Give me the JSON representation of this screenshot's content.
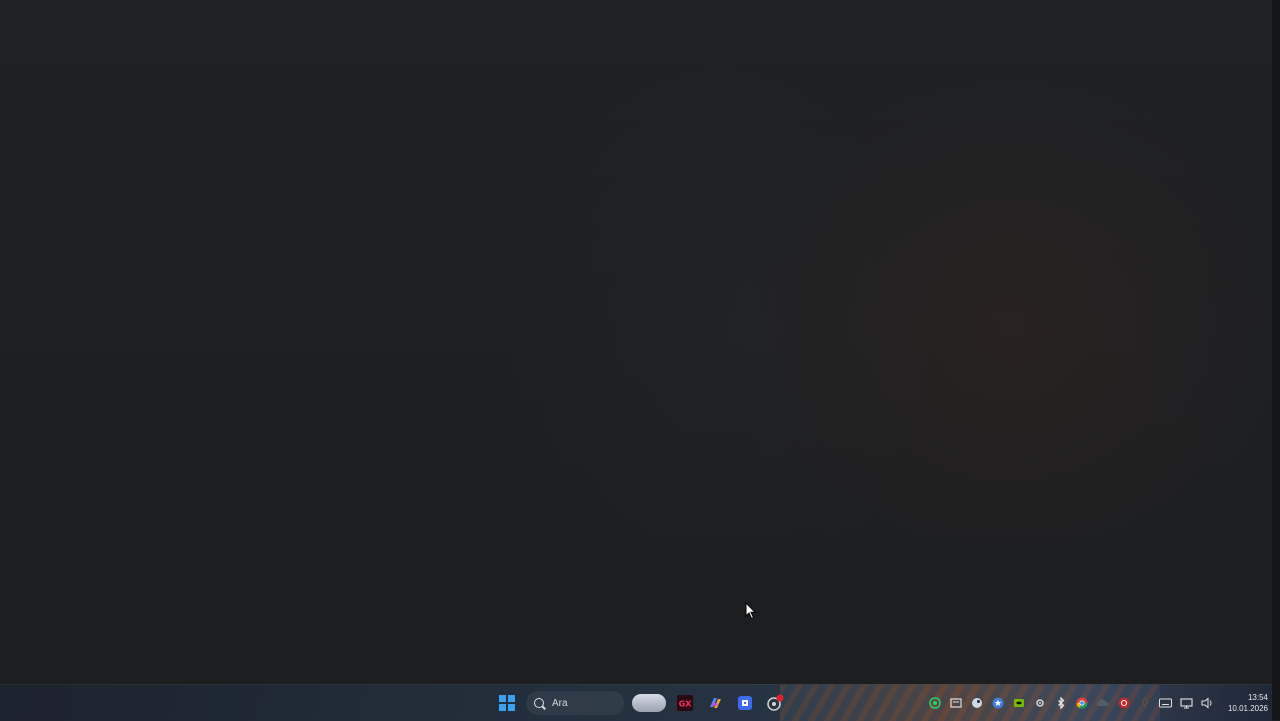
{
  "desktop": {
    "wallpaper": "dark abstract"
  },
  "taskbar": {
    "search": {
      "placeholder": "Ara",
      "value": ""
    },
    "pinned": [
      {
        "icon": "start-windows-icon"
      },
      {
        "icon": "search-icon"
      },
      {
        "icon": "weather-widget-icon"
      },
      {
        "icon": "opera-gx-icon"
      },
      {
        "icon": "copilot-icon"
      },
      {
        "icon": "roblox-icon"
      },
      {
        "icon": "steam-notification-icon"
      }
    ],
    "tray": [
      "whatsapp-icon",
      "app-icon",
      "steam-icon",
      "star-icon",
      "nvidia-icon",
      "settings-icon",
      "bluetooth-icon",
      "chrome-icon",
      "cloud-icon",
      "antivirus-icon",
      "mic-icon",
      "keyboard-icon",
      "network-icon",
      "volume-icon"
    ],
    "clock": {
      "time": "13:54",
      "date": "10.01.2026"
    }
  },
  "colors": {
    "accent": "#3aa0f0",
    "desktop_bg": "#1d1f22"
  }
}
